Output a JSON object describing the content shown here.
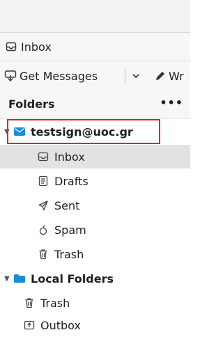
{
  "tab": {
    "label": "Inbox",
    "icon": "inbox-icon"
  },
  "toolbar": {
    "get_messages_label": "Get Messages",
    "write_label": "Wr",
    "icons": [
      "get-messages-icon",
      "dropdown-chevron-icon",
      "write-pencil-icon"
    ]
  },
  "folder_pane": {
    "title": "Folders",
    "more": "•••"
  },
  "accounts": [
    {
      "name": "testsign@uoc.gr",
      "icon": "mail-account-icon",
      "expanded": true,
      "highlighted": true,
      "folders": [
        {
          "label": "Inbox",
          "icon": "inbox-icon",
          "selected": true
        },
        {
          "label": "Drafts",
          "icon": "drafts-icon",
          "selected": false
        },
        {
          "label": "Sent",
          "icon": "sent-icon",
          "selected": false
        },
        {
          "label": "Spam",
          "icon": "spam-icon",
          "selected": false
        },
        {
          "label": "Trash",
          "icon": "trash-icon",
          "selected": false
        }
      ]
    },
    {
      "name": "Local Folders",
      "icon": "folder-icon",
      "expanded": true,
      "highlighted": false,
      "folders": [
        {
          "label": "Trash",
          "icon": "trash-icon",
          "selected": false
        },
        {
          "label": "Outbox",
          "icon": "outbox-icon",
          "selected": false
        }
      ]
    }
  ],
  "colors": {
    "highlight_border": "#d9262d",
    "account_icon": "#1a8cd8",
    "folder_icon": "#1a8cd8",
    "selected_row": "#e2e2e2"
  }
}
